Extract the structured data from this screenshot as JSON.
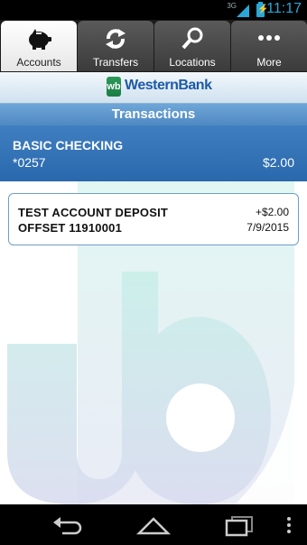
{
  "status": {
    "network": "3G",
    "time": "11:17"
  },
  "tabs": [
    {
      "label": "Accounts",
      "icon": "piggy-bank-icon",
      "active": true
    },
    {
      "label": "Transfers",
      "icon": "transfer-arrows-icon",
      "active": false
    },
    {
      "label": "Locations",
      "icon": "search-icon",
      "active": false
    },
    {
      "label": "More",
      "icon": "more-dots-icon",
      "active": false
    }
  ],
  "brand": {
    "name": "WesternBank",
    "mark": "wb"
  },
  "page": {
    "title": "Transactions"
  },
  "account": {
    "name": "BASIC CHECKING",
    "number": "*0257",
    "balance": "$2.00"
  },
  "transactions": [
    {
      "line1": "TEST ACCOUNT DEPOSIT",
      "line2": "OFFSET 11910001",
      "amount": "+$2.00",
      "date": "7/9/2015"
    }
  ],
  "colors": {
    "accent": "#2a68ad",
    "title_bar": "#5b95cc",
    "watermark": "#bfe9e3"
  },
  "nav": {
    "back_icon": "back-icon",
    "home_icon": "home-icon",
    "recents_icon": "recent-apps-icon",
    "menu_icon": "menu-dots-icon"
  }
}
